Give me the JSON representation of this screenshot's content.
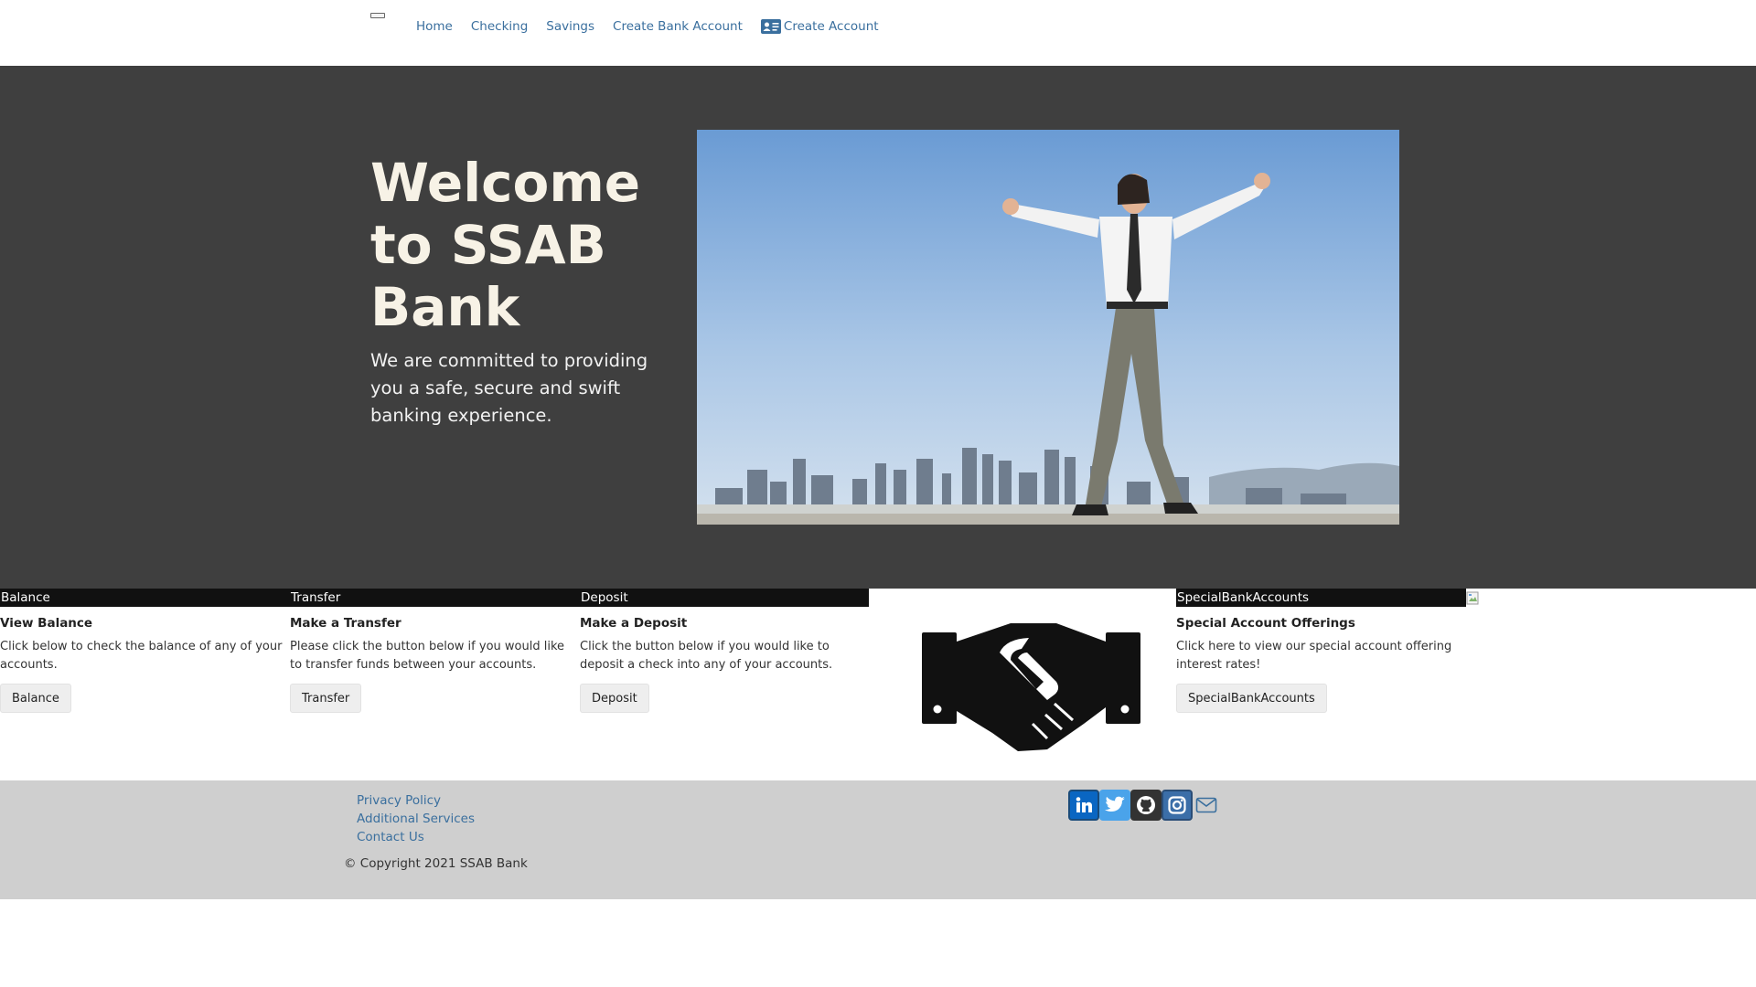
{
  "nav": {
    "links": [
      "Home",
      "Checking",
      "Savings",
      "Create Bank Account"
    ],
    "create_account": "Create Account"
  },
  "hero": {
    "title": "Welcome to SSAB Bank",
    "subtitle": "We are committed to providing you a safe, secure and swift banking experience."
  },
  "cards": [
    {
      "header": "Balance",
      "title": "View Balance",
      "text": "Click below to check the balance of any of your accounts.",
      "button": "Balance"
    },
    {
      "header": "Transfer",
      "title": "Make a Transfer",
      "text": "Please click the button below if you would like to transfer funds between your accounts.",
      "button": "Transfer"
    },
    {
      "header": "Deposit",
      "title": "Make a Deposit",
      "text": "Click the button below if you would like to deposit a check into any of your accounts.",
      "button": "Deposit"
    },
    {
      "header": "SpecialBankAccounts",
      "title": "Special Account Offerings",
      "text": "Click here to view our special account offering interest rates!",
      "button": "SpecialBankAccounts"
    }
  ],
  "footer": {
    "links": [
      "Privacy Policy",
      "Additional Services",
      "Contact Us"
    ],
    "copyright": "© Copyright 2021 SSAB Bank"
  },
  "colors": {
    "link": "#3a6f9e",
    "hero_bg": "#3f3f3f",
    "footer_bg": "#cfcfcf"
  },
  "icons": [
    "menu-toggle-icon",
    "id-card-icon",
    "handshake-icon",
    "broken-image-icon",
    "linkedin-icon",
    "twitter-icon",
    "github-icon",
    "instagram-icon",
    "mail-icon"
  ]
}
